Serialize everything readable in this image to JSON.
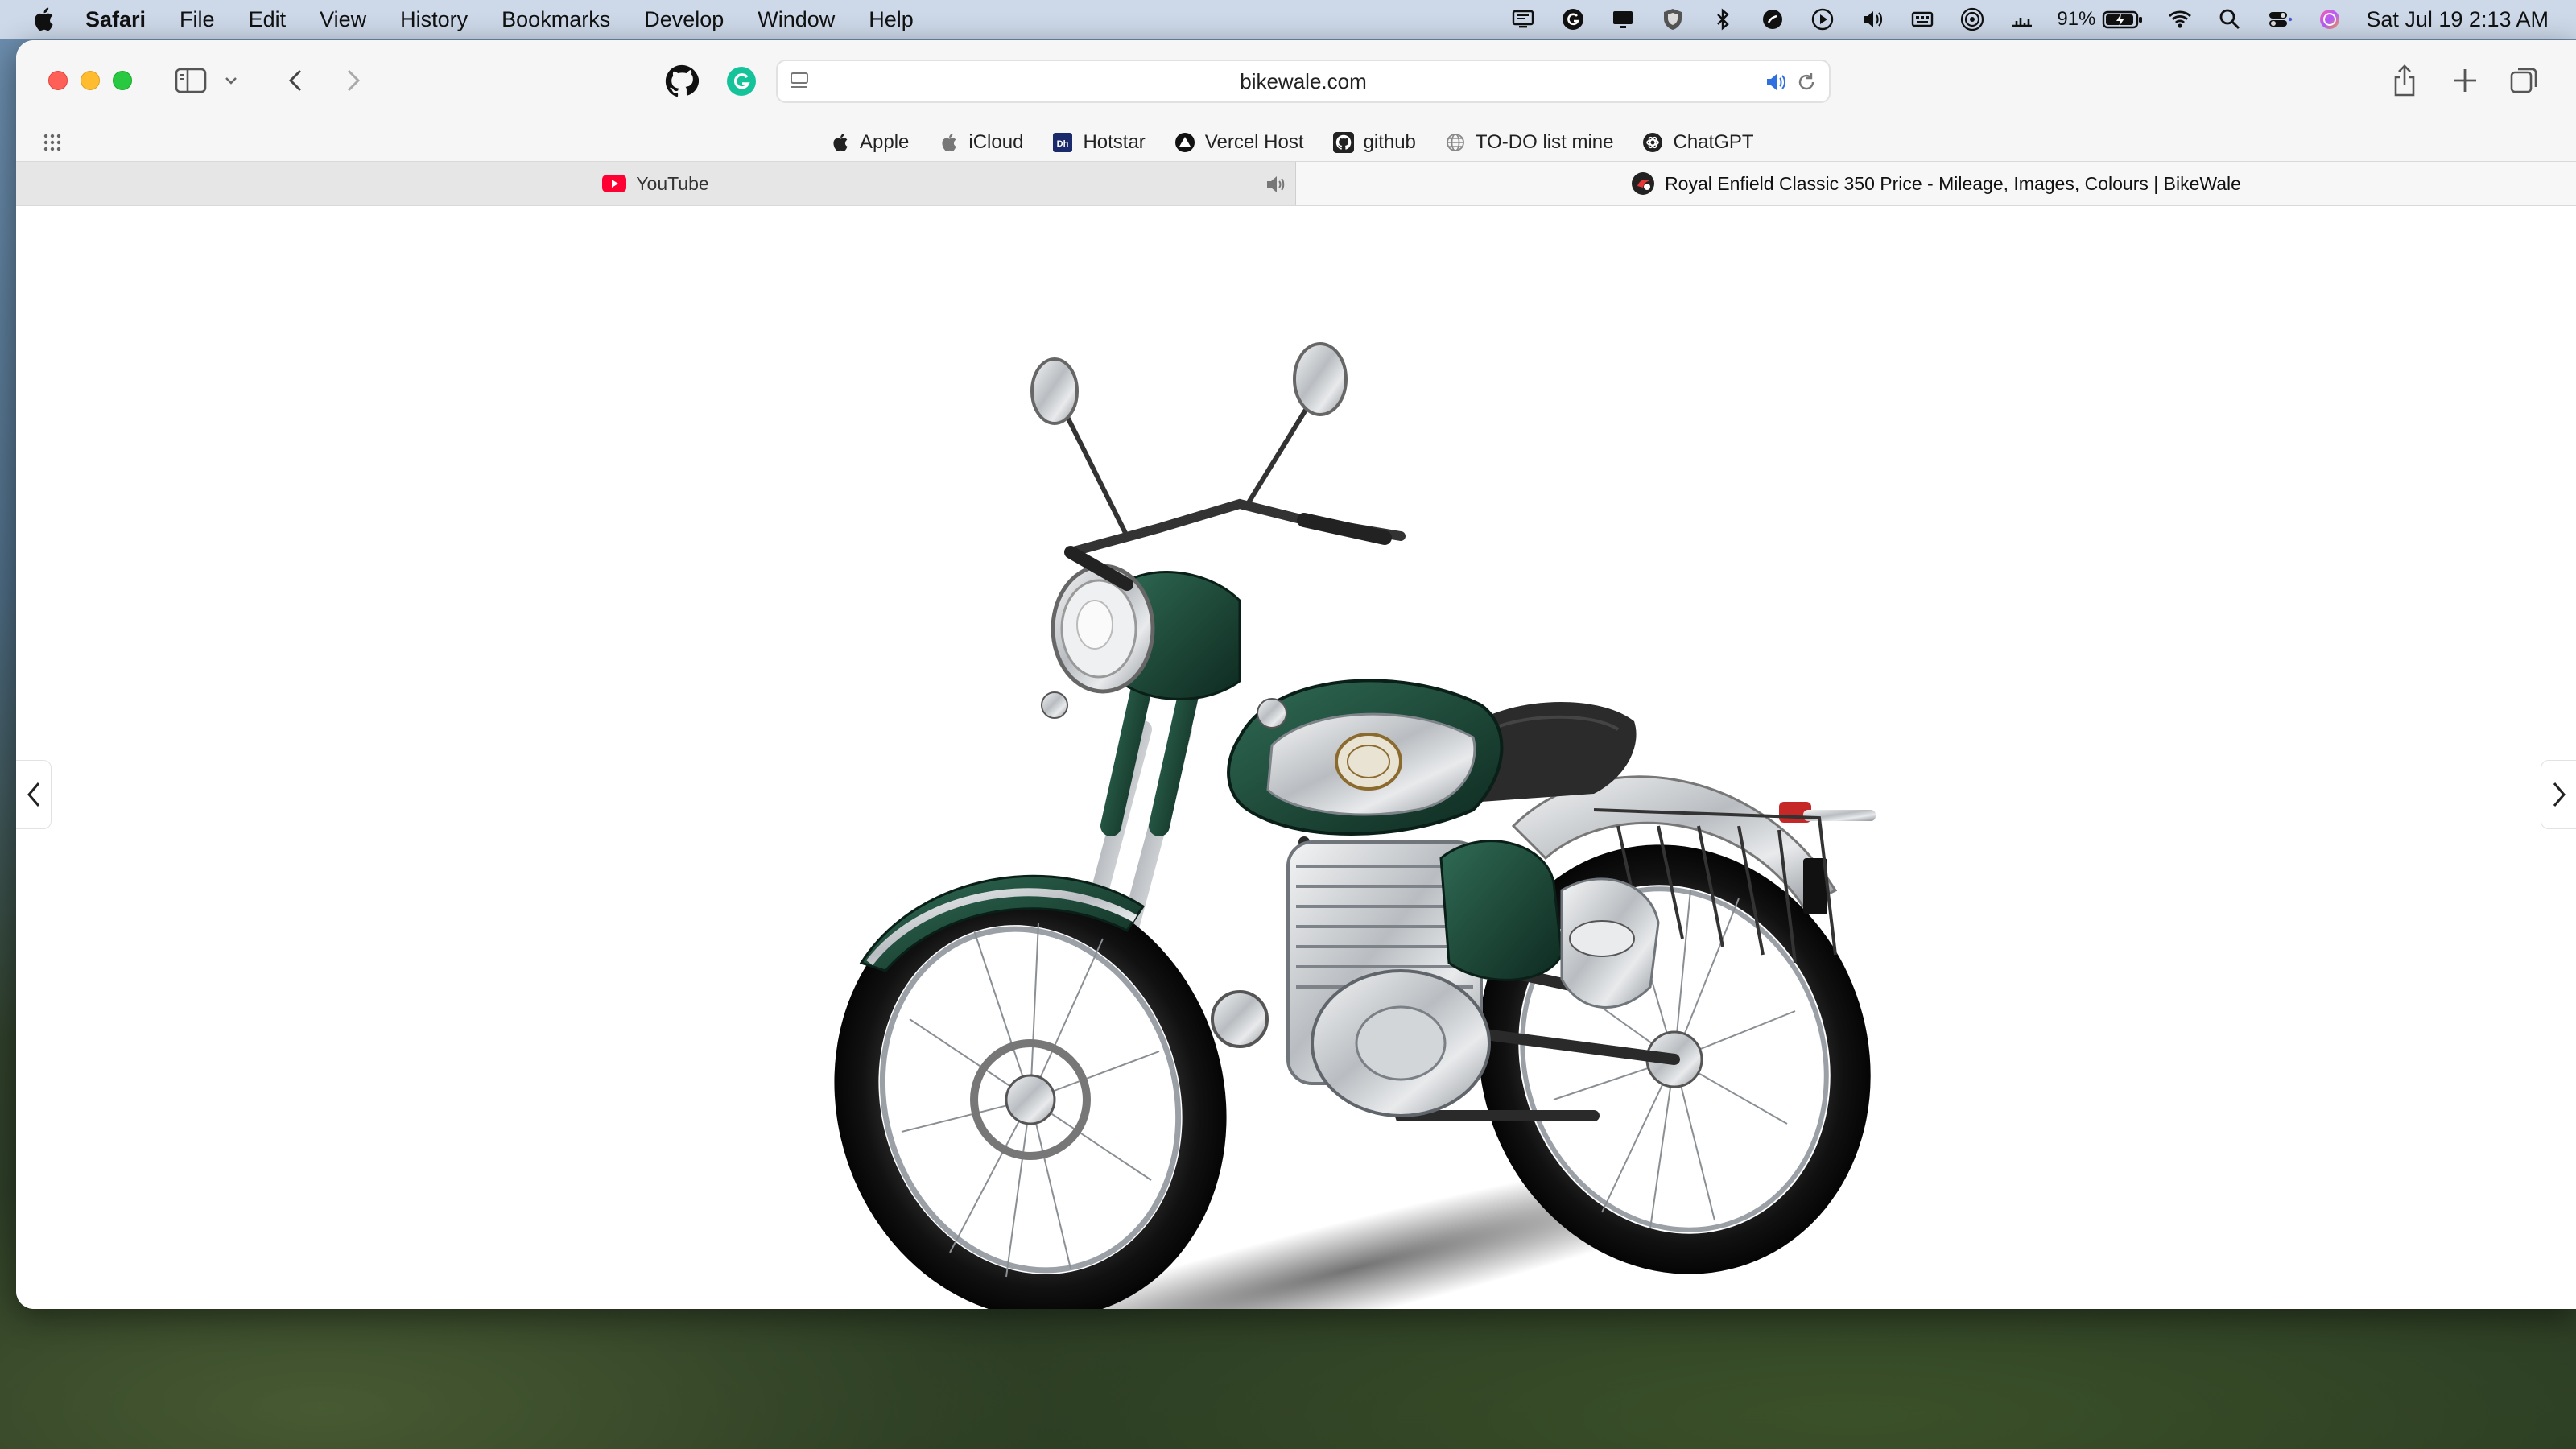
{
  "menubar": {
    "app_name": "Safari",
    "menus": [
      "File",
      "Edit",
      "View",
      "History",
      "Bookmarks",
      "Develop",
      "Window",
      "Help"
    ],
    "status_icons": [
      "display-icon",
      "grammarly-icon",
      "screen-mirror-icon",
      "shield-icon",
      "bluetooth-icon",
      "vpn-icon",
      "play-icon",
      "volume-icon",
      "keyboard-icon",
      "airdrop-icon",
      "activity-icon"
    ],
    "battery_percent": "91%",
    "clock": "Sat Jul 19  2:13 AM"
  },
  "toolbar": {
    "url": "bikewale.com",
    "extension_icons": [
      "github-icon",
      "grammarly-icon"
    ]
  },
  "bookmarks": [
    {
      "label": "Apple",
      "icon": "apple-icon"
    },
    {
      "label": "iCloud",
      "icon": "apple-icon"
    },
    {
      "label": "Hotstar",
      "icon": "hotstar-icon"
    },
    {
      "label": "Vercel Host",
      "icon": "vercel-icon"
    },
    {
      "label": "github",
      "icon": "github-icon"
    },
    {
      "label": "TO-DO list mine",
      "icon": "globe-icon"
    },
    {
      "label": "ChatGPT",
      "icon": "chatgpt-icon"
    }
  ],
  "tabs": [
    {
      "title": "YouTube",
      "active": false,
      "audio_playing": true
    },
    {
      "title": "Royal Enfield Classic 350 Price - Mileage, Images, Colours | BikeWale",
      "active": true
    }
  ],
  "content": {
    "image": "royal-enfield-classic-350-motorcycle",
    "colors": {
      "tank": "#1f4a3a",
      "chrome": "#c8cbce"
    }
  }
}
